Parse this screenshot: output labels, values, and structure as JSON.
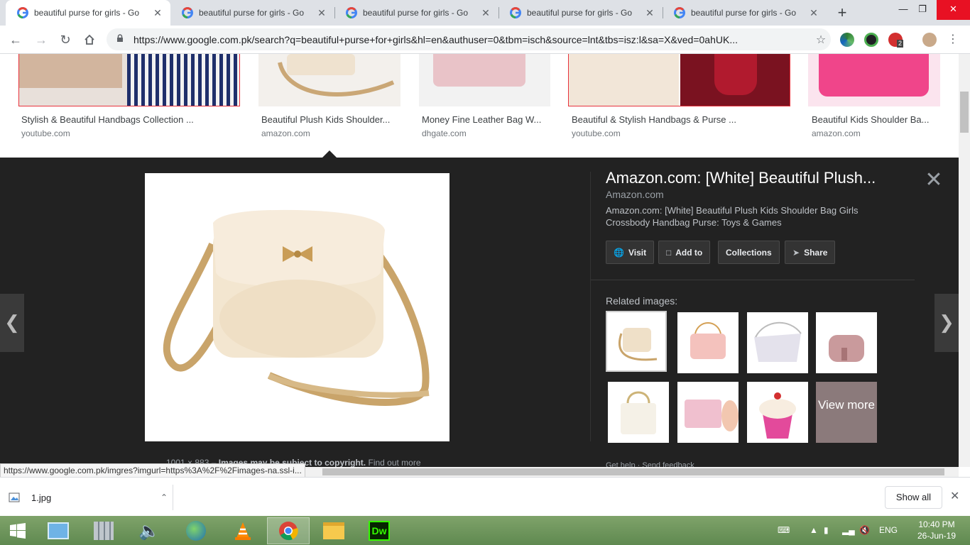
{
  "browser": {
    "tabs": [
      {
        "title": "beautiful purse for girls - Go",
        "active": true
      },
      {
        "title": "beautiful purse for girls - Go",
        "active": false
      },
      {
        "title": "beautiful purse for girls - Go",
        "active": false
      },
      {
        "title": "beautiful purse for girls - Go",
        "active": false
      },
      {
        "title": "beautiful purse for girls - Go",
        "active": false
      }
    ],
    "new_tab_symbol": "+",
    "address": "https://www.google.com.pk/search?q=beautiful+purse+for+girls&hl=en&authuser=0&tbm=isch&source=lnt&tbs=isz:l&sa=X&ved=0ahUK...",
    "extension_badge": "2"
  },
  "results": [
    {
      "title": "Stylish & Beautiful Handbags Collection ...",
      "source": "youtube.com"
    },
    {
      "title": "Beautiful Plush Kids Shoulder...",
      "source": "amazon.com"
    },
    {
      "title": "Money Fine Leather Bag W...",
      "source": "dhgate.com"
    },
    {
      "title": "Beautiful & Stylish Handbags & Purse ...",
      "source": "youtube.com"
    },
    {
      "title": "Beautiful Kids Shoulder Ba...",
      "source": "amazon.com"
    }
  ],
  "preview": {
    "title": "Amazon.com: [White] Beautiful Plush...",
    "domain": "Amazon.com",
    "description": "Amazon.com: [White] Beautiful Plush Kids Shoulder Bag Girls Crossbody Handbag Purse: Toys & Games",
    "buttons": {
      "visit": "Visit",
      "add_to": "Add to",
      "collections": "Collections",
      "share": "Share"
    },
    "related_label": "Related images:",
    "view_more": "View more",
    "meta_dims": "1001 × 883",
    "meta_notice": "Images may be subject to copyright.",
    "meta_link": "Find out more",
    "footer": "Get help · Send feedback"
  },
  "status_url": "https://www.google.com.pk/imgres?imgurl=https%3A%2F%2Fimages-na.ssl-i...",
  "downloads": {
    "file": "1.jpg",
    "show_all": "Show all"
  },
  "taskbar": {
    "language": "ENG",
    "time": "10:40 PM",
    "date": "26-Jun-19"
  },
  "colors": {
    "panel_bg": "#222222",
    "selected_border": "#e8323c",
    "taskbar": "#6b9a58"
  }
}
